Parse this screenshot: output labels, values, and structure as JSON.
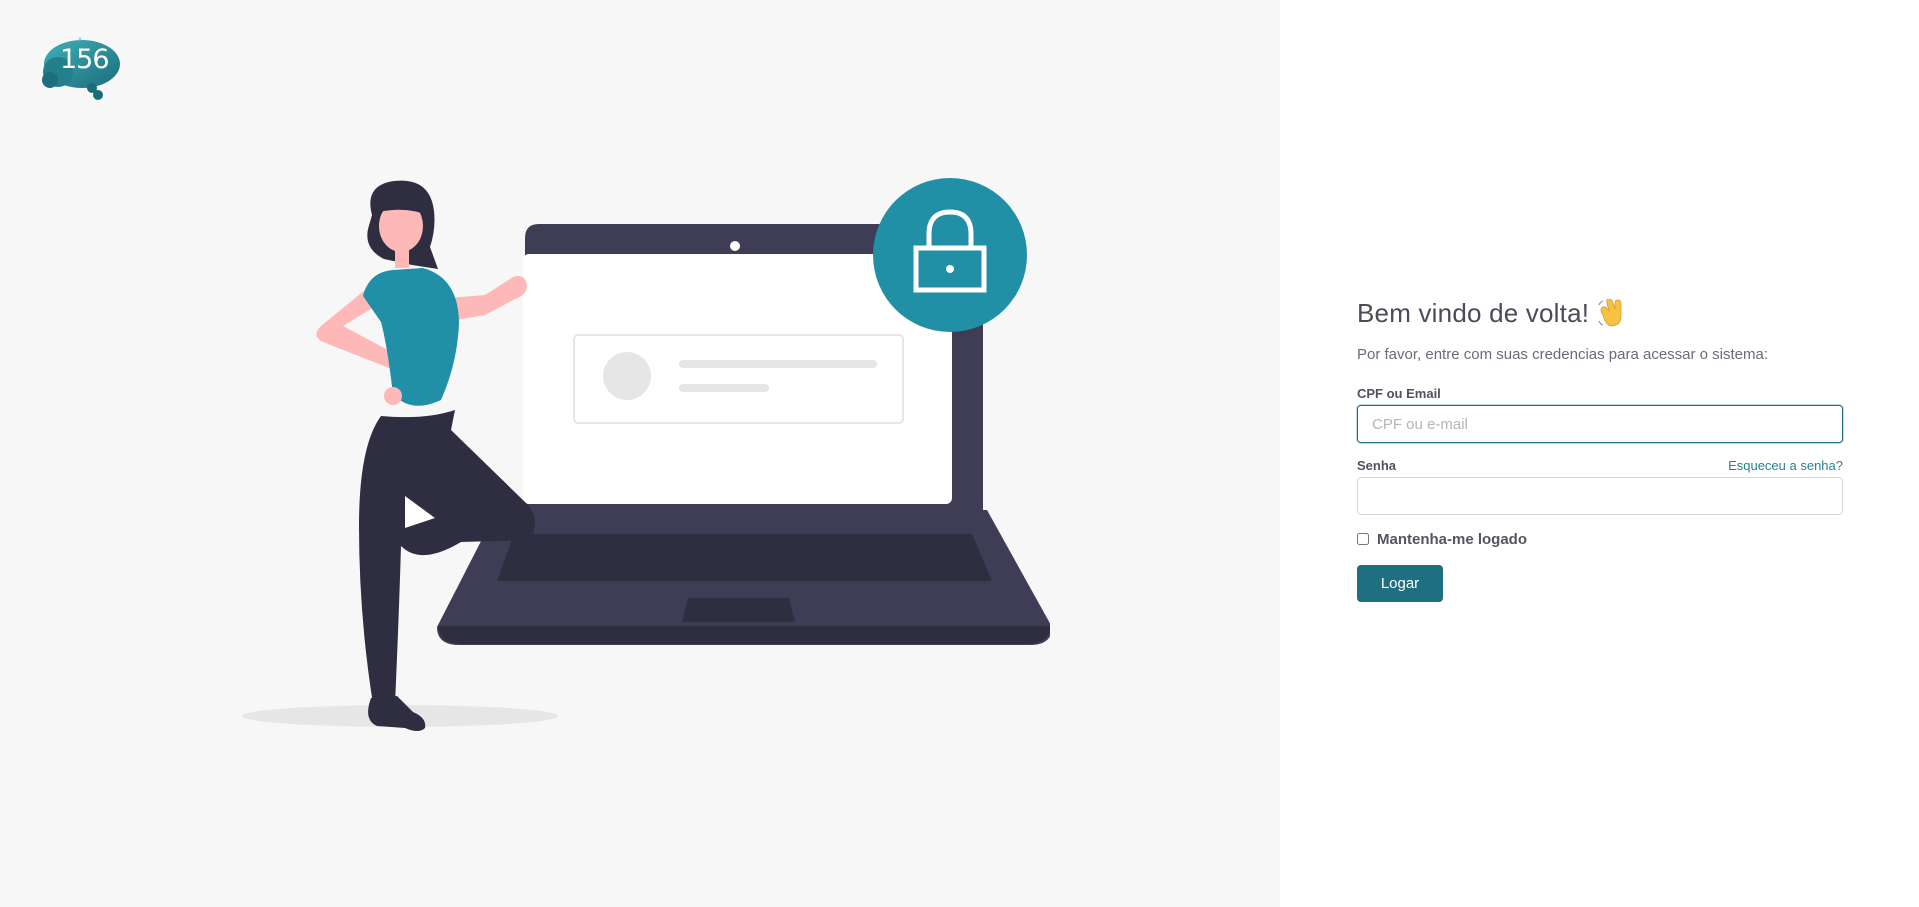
{
  "brand": {
    "logo_text": "156"
  },
  "login": {
    "title": "Bem vindo de volta!",
    "subtitle": "Por favor, entre com suas credencias para acessar o sistema:",
    "email_label": "CPF ou Email",
    "email_placeholder": "CPF ou e-mail",
    "email_value": "",
    "password_label": "Senha",
    "password_value": "",
    "forgot_link": "Esqueceu a senha?",
    "remember_label": "Mantenha-me logado",
    "remember_checked": false,
    "submit_label": "Logar"
  },
  "icons": {
    "wave": "waving-hand-icon",
    "lock": "lock-icon"
  },
  "colors": {
    "accent": "#2190a6",
    "button": "#1e6f80",
    "left_background": "#f7f7f7",
    "laptop": "#3f3d56"
  }
}
